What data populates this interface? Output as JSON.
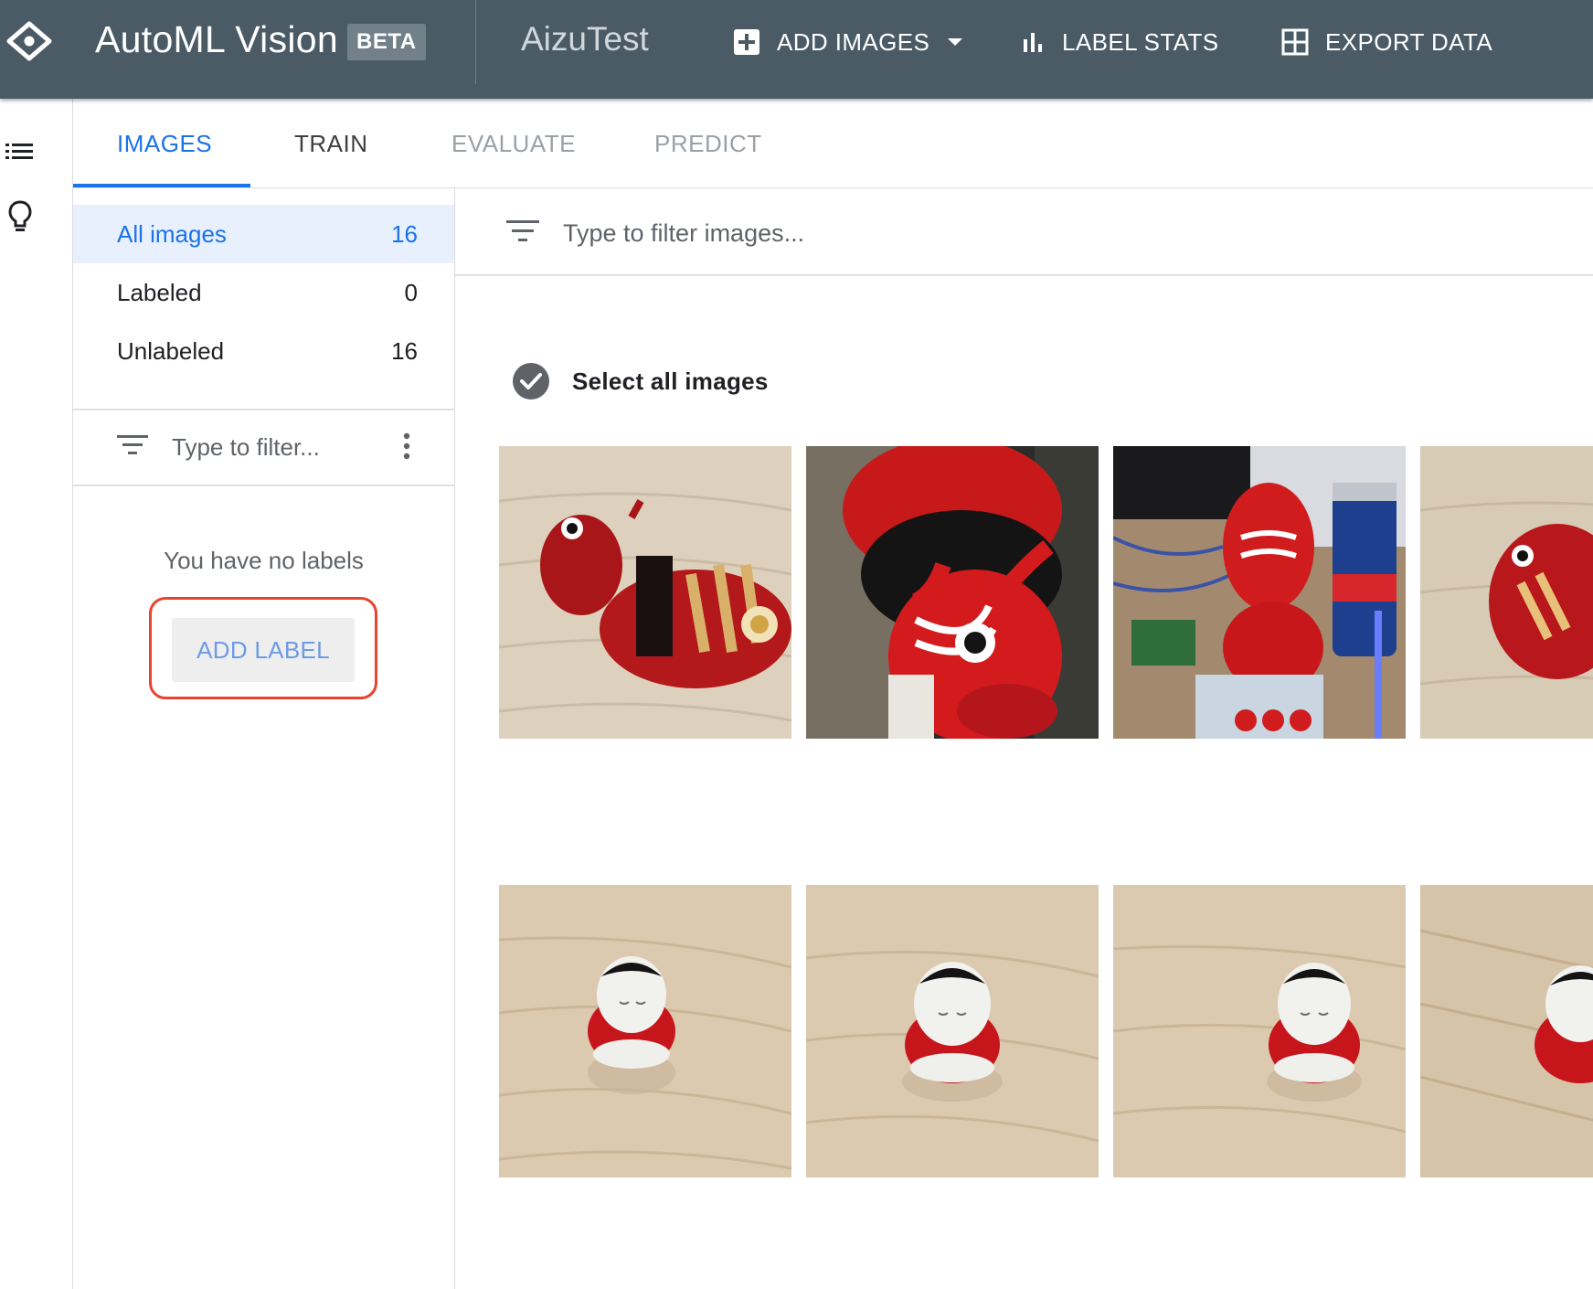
{
  "header": {
    "app_title": "AutoML Vision",
    "beta_badge": "BETA",
    "dataset_name": "AizuTest",
    "add_images_label": "ADD IMAGES",
    "label_stats_label": "LABEL STATS",
    "export_data_label": "EXPORT DATA"
  },
  "tabs": [
    {
      "label": "IMAGES",
      "state": "active"
    },
    {
      "label": "TRAIN",
      "state": "enabled"
    },
    {
      "label": "EVALUATE",
      "state": "disabled"
    },
    {
      "label": "PREDICT",
      "state": "disabled"
    }
  ],
  "sidebar": {
    "categories": [
      {
        "label": "All images",
        "count": "16",
        "active": true
      },
      {
        "label": "Labeled",
        "count": "0",
        "active": false
      },
      {
        "label": "Unlabeled",
        "count": "16",
        "active": false
      }
    ],
    "label_filter_placeholder": "Type to filter...",
    "empty_message": "You have no labels",
    "add_label_button": "ADD LABEL"
  },
  "main": {
    "image_filter_placeholder": "Type to filter images...",
    "select_all_label": "Select all images",
    "images": [
      {
        "subject": "red cow figurine (akabeko) on wooden table"
      },
      {
        "subject": "large red cow figure close-up"
      },
      {
        "subject": "red cow figurine with electronics and a drink can"
      },
      {
        "subject": "red cow figurine, partially visible"
      },
      {
        "subject": "small doll figurine on wooden table"
      },
      {
        "subject": "small doll figurine on wooden table"
      },
      {
        "subject": "small doll figurine on wooden table"
      },
      {
        "subject": "small doll figurine, partially visible"
      }
    ]
  },
  "colors": {
    "header_bg": "#4a5b66",
    "accent_blue": "#1a73e8",
    "highlight_ring": "#e8432f"
  },
  "icons": [
    "automl-logo-icon",
    "add-box-icon",
    "dropdown-caret-icon",
    "bar-chart-icon",
    "grid-icon",
    "list-icon",
    "lightbulb-icon",
    "filter-icon",
    "more-vert-icon",
    "check-circle-icon"
  ]
}
